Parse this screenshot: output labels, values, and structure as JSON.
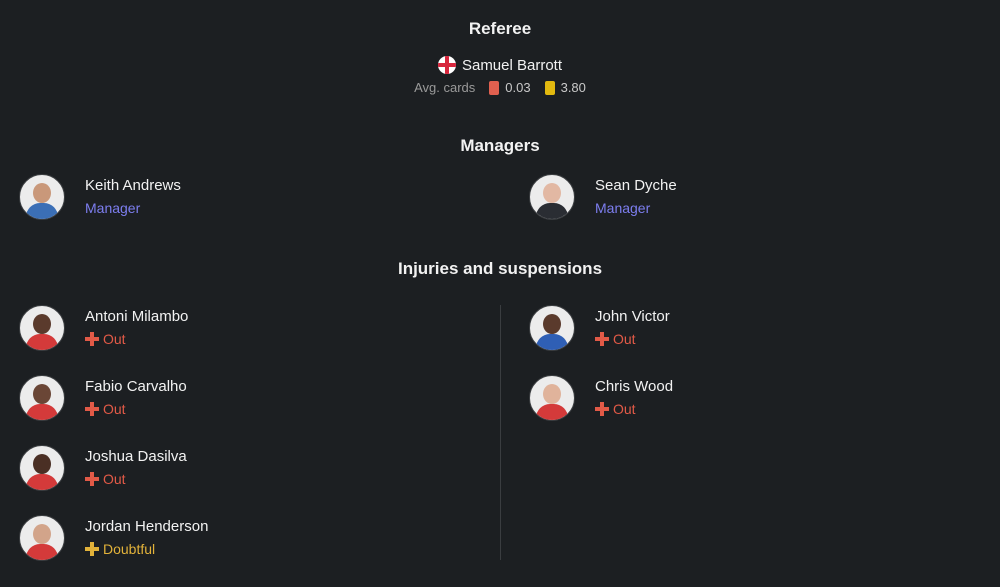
{
  "referee": {
    "title": "Referee",
    "name": "Samuel Barrott",
    "flag_icon": "england-flag-icon",
    "avg_cards_label": "Avg. cards",
    "red_avg": "0.03",
    "yellow_avg": "3.80"
  },
  "managers": {
    "title": "Managers",
    "home": {
      "name": "Keith Andrews",
      "role": "Manager"
    },
    "away": {
      "name": "Sean Dyche",
      "role": "Manager"
    }
  },
  "injuries": {
    "title": "Injuries and suspensions",
    "home": [
      {
        "name": "Antoni Milambo",
        "status": "Out"
      },
      {
        "name": "Fabio Carvalho",
        "status": "Out"
      },
      {
        "name": "Joshua Dasilva",
        "status": "Out"
      },
      {
        "name": "Jordan Henderson",
        "status": "Doubtful"
      }
    ],
    "away": [
      {
        "name": "John Victor",
        "status": "Out"
      },
      {
        "name": "Chris Wood",
        "status": "Out"
      }
    ]
  },
  "colors": {
    "background": "#1c1f22",
    "manager_role": "#7d7ef0",
    "status_out": "#e25a47",
    "status_doubtful": "#e2b23a",
    "red_card": "#e0604f",
    "yellow_card": "#e2b90f"
  }
}
